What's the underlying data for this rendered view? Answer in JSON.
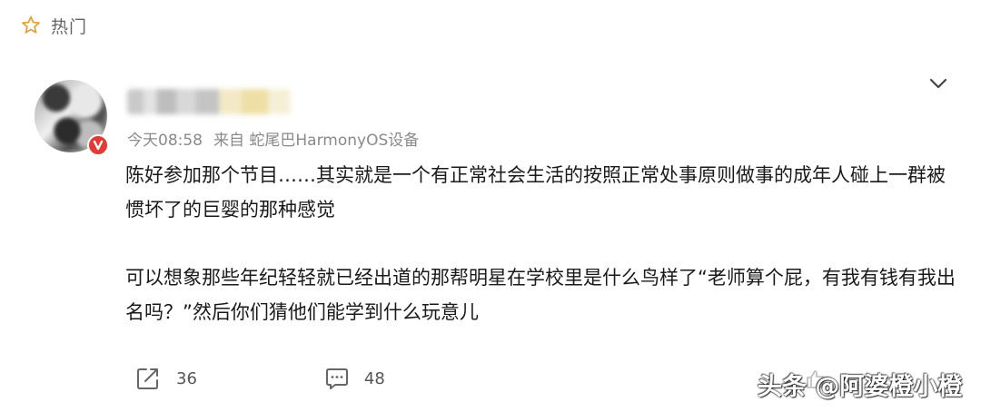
{
  "tab": {
    "icon": "star-icon",
    "label": "热门"
  },
  "comment": {
    "username": "",
    "meta": {
      "time": "今天08:58",
      "source": "来自 蛇尾巴HarmonyOS设备"
    },
    "paragraphs": [
      "陈好参加那个节目……其实就是一个有正常社会生活的按照正常处事原则做事的成年人碰上一群被惯坏了的巨婴的那种感觉",
      "可以想象那些年纪轻轻就已经出道的那帮明星在学校里是什么鸟样了“老师算个屁，有我有钱有我出名吗？”然后你们猜他们能学到什么玩意儿"
    ],
    "actions": {
      "repost_count": "36",
      "comment_count": "48"
    }
  },
  "watermark": {
    "text": "头条 @阿婆橙小橙"
  },
  "colors": {
    "accent_red": "#e53935",
    "text_primary": "#1a1a1a",
    "text_secondary": "#8a8a8a"
  }
}
